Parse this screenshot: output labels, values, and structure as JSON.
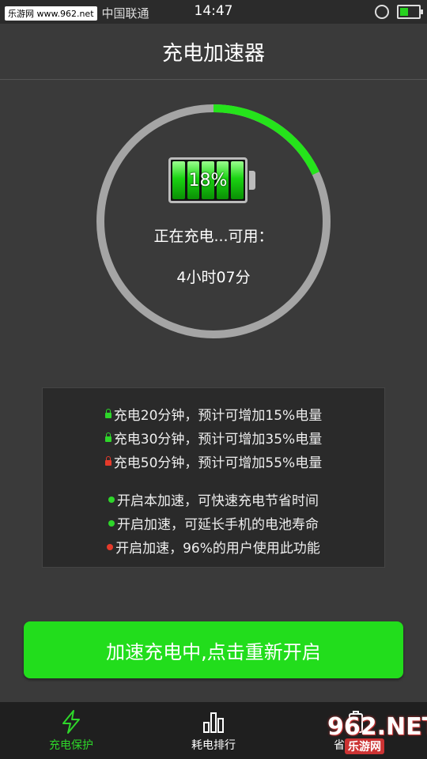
{
  "status_bar": {
    "watermark": "乐游网 www.962.net",
    "carrier": "中国联通",
    "time": "14:47",
    "icons": [
      "notification-icon",
      "notification-icon",
      "alarm-icon",
      "battery-charging-icon"
    ]
  },
  "header": {
    "title": "充电加速器"
  },
  "charge_ring": {
    "percent": 18,
    "percent_label": "18%",
    "status_label": "正在充电...可用：",
    "remaining": "4小时07分",
    "track_color": "#a5a5a5",
    "progress_color": "#25e31b"
  },
  "tips": {
    "estimates": [
      {
        "text": "充电20分钟，预计可增加15%电量",
        "icon_color": "#2ed62a"
      },
      {
        "text": "充电30分钟，预计可增加35%电量",
        "icon_color": "#2ed62a"
      },
      {
        "text": "充电50分钟，预计可增加55%电量",
        "icon_color": "#e53a2a"
      }
    ],
    "benefits": [
      {
        "text": "开启本加速，可快速充电节省时间",
        "dot_color": "#2ed62a"
      },
      {
        "text": "开启加速，可延长手机的电池寿命",
        "dot_color": "#2ed62a"
      },
      {
        "text": "开启加速，96%的用户使用此功能",
        "dot_color": "#e53a2a"
      }
    ]
  },
  "action_button": {
    "label": "加速充电中,点击重新开启"
  },
  "bottom_nav": {
    "items": [
      {
        "label": "充电保护",
        "icon": "lightning-icon",
        "active": true
      },
      {
        "label": "耗电排行",
        "icon": "bar-chart-icon",
        "active": false
      },
      {
        "label": "省电模式",
        "icon": "battery-icon",
        "active": false
      }
    ],
    "active_color": "#2ed62a",
    "watermark": {
      "main": "962.NET",
      "sub": "乐游网"
    }
  }
}
